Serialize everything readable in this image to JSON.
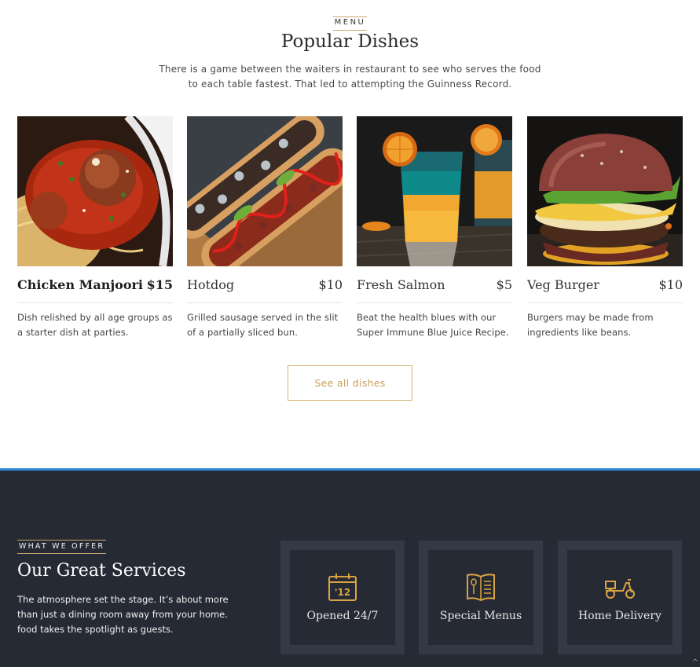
{
  "menu": {
    "eyebrow": "MENU",
    "title": "Popular Dishes",
    "description": "There is a game between the waiters in restaurant to see who serves the food to each table fastest. That led to attempting the Guinness Record.",
    "dishes": [
      {
        "name": "Chicken Manjoori",
        "price": "$15",
        "description": "Dish relished by all age groups as a starter dish at parties."
      },
      {
        "name": "Hotdog",
        "price": "$10",
        "description": "Grilled sausage served in the slit of a partially sliced bun."
      },
      {
        "name": "Fresh Salmon",
        "price": "$5",
        "description": "Beat the health blues with our Super Immune Blue Juice Recipe."
      },
      {
        "name": "Veg Burger",
        "price": "$10",
        "description": "Burgers may be made from ingredients like beans."
      }
    ],
    "see_all_label": "See all dishes"
  },
  "services": {
    "eyebrow": "WHAT WE OFFER",
    "title": "Our Great Services",
    "description": "The atmosphere set the stage. It’s about more than just a dining room away from your home. food takes the spotlight as guests.",
    "items": [
      {
        "label": "Opened 24/7",
        "icon": "calendar-icon",
        "icon_text": "'12"
      },
      {
        "label": "Special Menus",
        "icon": "menu-book-icon"
      },
      {
        "label": "Home Delivery",
        "icon": "scooter-icon"
      }
    ]
  },
  "colors": {
    "accent_gold": "#c9a15c",
    "dark_bg": "#262a35",
    "card_bg": "#343945",
    "divider_blue": "#2f86d6"
  },
  "scroll_top_glyph": "^"
}
